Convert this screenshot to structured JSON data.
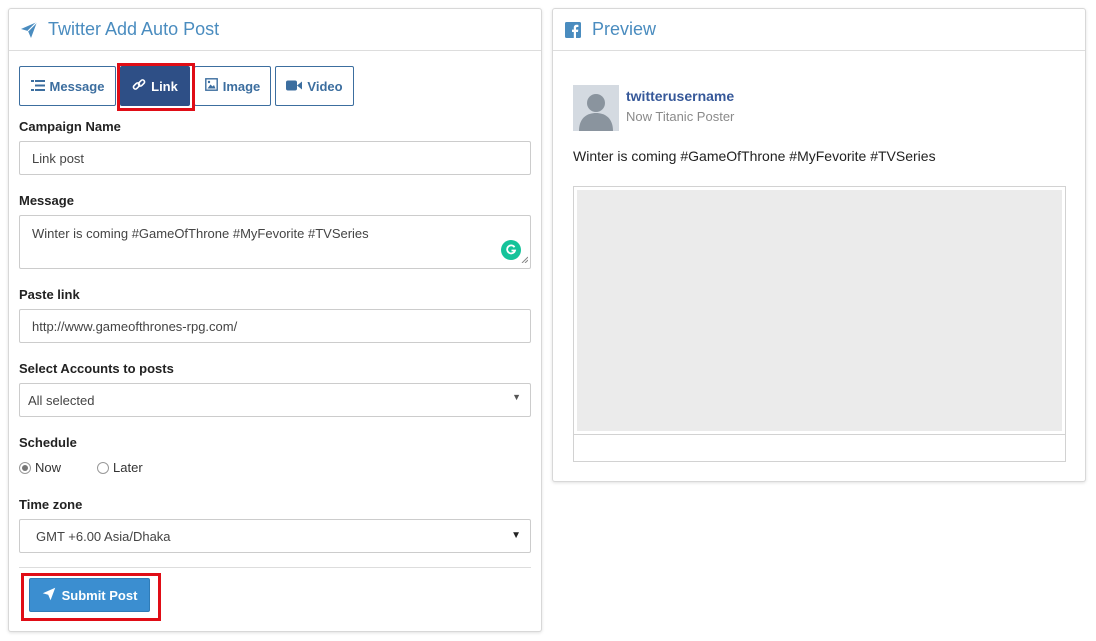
{
  "left_panel": {
    "title": "Twitter Add Auto Post",
    "tabs": [
      {
        "label": "Message",
        "icon": "list-icon",
        "active": false
      },
      {
        "label": "Link",
        "icon": "link-icon",
        "active": true
      },
      {
        "label": "Image",
        "icon": "image-icon",
        "active": false
      },
      {
        "label": "Video",
        "icon": "video-icon",
        "active": false
      }
    ],
    "campaign_name": {
      "label": "Campaign Name",
      "value": "Link post"
    },
    "message": {
      "label": "Message",
      "value": "Winter is coming #GameOfThrone #MyFevorite #TVSeries"
    },
    "paste_link": {
      "label": "Paste link",
      "value": "http://www.gameofthrones-rpg.com/"
    },
    "accounts": {
      "label": "Select Accounts to posts",
      "value": "All selected"
    },
    "schedule": {
      "label": "Schedule",
      "options": [
        "Now",
        "Later"
      ],
      "selected": "Now"
    },
    "timezone": {
      "label": "Time zone",
      "value": "GMT +6.00 Asia/Dhaka"
    },
    "submit_label": "Submit Post"
  },
  "preview_panel": {
    "title": "Preview",
    "username": "twitterusername",
    "subline": "Now Titanic Poster",
    "message": "Winter is coming #GameOfThrone #MyFevorite #TVSeries"
  },
  "colors": {
    "accent": "#4a8cbf",
    "active_tab": "#2e4f86",
    "submit": "#3b8ed0",
    "highlight": "#e00d16",
    "grammarly": "#15c39a"
  }
}
